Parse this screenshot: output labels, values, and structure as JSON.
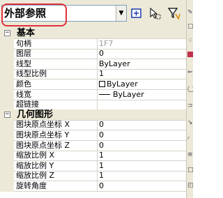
{
  "toolbar": {
    "object_type": "外部参照",
    "buttons": [
      {
        "name": "toggle-pickadd-icon"
      },
      {
        "name": "select-objects-icon"
      },
      {
        "name": "quick-select-icon"
      }
    ]
  },
  "categories": [
    {
      "label": "基本",
      "toggle": "−",
      "properties": [
        {
          "name": "句柄",
          "value": "1F7",
          "readonly": true
        },
        {
          "name": "图层",
          "value": "0"
        },
        {
          "name": "线型",
          "value": "ByLayer"
        },
        {
          "name": "线型比例",
          "value": "1"
        },
        {
          "name": "颜色",
          "value": "ByLayer",
          "kind": "color"
        },
        {
          "name": "线宽",
          "value": "ByLayer",
          "kind": "lineweight"
        },
        {
          "name": "超链接",
          "value": ""
        }
      ]
    },
    {
      "label": "几何图形",
      "toggle": "−",
      "properties": [
        {
          "name": "图块原点坐标 X",
          "value": "0"
        },
        {
          "name": "图块原点坐标 Y",
          "value": "0"
        },
        {
          "name": "图块原点坐标 Z",
          "value": "0"
        },
        {
          "name": "缩放比例 X",
          "value": "1"
        },
        {
          "name": "缩放比例 Y",
          "value": "1"
        },
        {
          "name": "缩放比例 Z",
          "value": "1"
        },
        {
          "name": "旋转角度",
          "value": "0"
        }
      ]
    }
  ],
  "colors": {
    "highlight_ring": "#e0303a",
    "panel": "#ece9d8",
    "readonly_text": "#9a9a9a"
  }
}
